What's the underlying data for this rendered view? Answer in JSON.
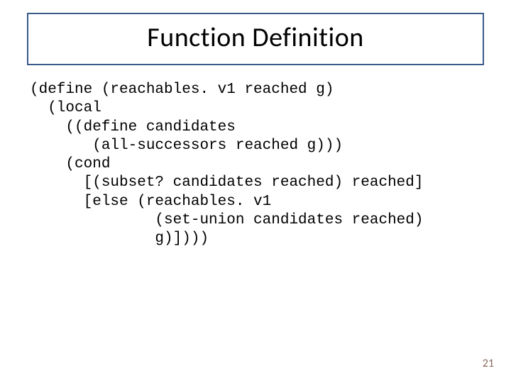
{
  "title": "Function Definition",
  "code": {
    "l1": "(define (reachables. v1 reached g)",
    "l2": "  (local",
    "l3": "    ((define candidates",
    "l4": "       (all-successors reached g)))",
    "l5": "    (cond",
    "l6": "      [(subset? candidates reached) reached]",
    "l7": "      [else (reachables. v1",
    "l8": "              (set-union candidates reached)",
    "l9": "              g)])))"
  },
  "page_number": "21"
}
